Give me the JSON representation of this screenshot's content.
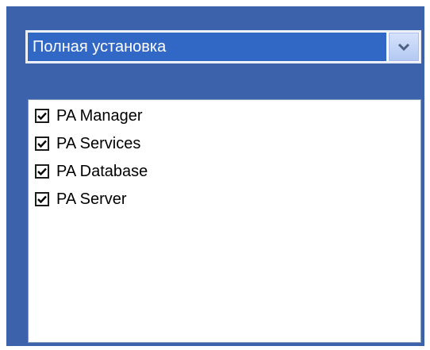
{
  "install_type": {
    "selected": "Полная установка",
    "dropdown_icon": "chevron-down-icon"
  },
  "components": [
    {
      "label": "PA Manager",
      "checked": true
    },
    {
      "label": "PA Services",
      "checked": true
    },
    {
      "label": "PA Database",
      "checked": true
    },
    {
      "label": "PA Server",
      "checked": true
    }
  ],
  "colors": {
    "panel_background": "#3c62ab",
    "selection_highlight": "#3168c6",
    "list_background": "#ffffff"
  }
}
